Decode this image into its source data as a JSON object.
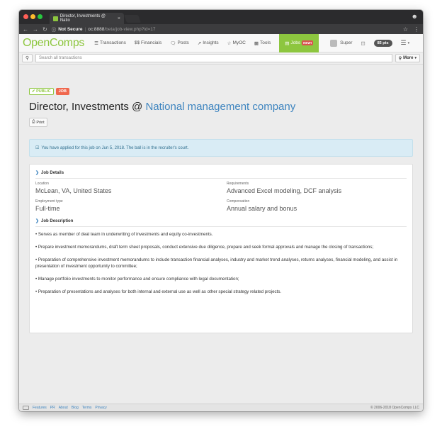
{
  "browser": {
    "tab_title": "Director, Investments @ Natio",
    "tab_close": "×",
    "security": "Not Secure",
    "url_host": "oc:8888",
    "url_path": "/beta/job-view.php?id=17"
  },
  "colors": {
    "brand": "#8dc63f",
    "link": "#3d84bf",
    "job_badge": "#f0684e",
    "alert_bg": "#d9ecf5"
  },
  "nav": {
    "logo": "OpenComps",
    "items": [
      {
        "label": "Transactions",
        "icon": "list-icon"
      },
      {
        "label": "$$ Financials",
        "icon": ""
      },
      {
        "label": "Posts",
        "icon": "chat-icon"
      },
      {
        "label": "Insights",
        "icon": "line-chart-icon"
      },
      {
        "label": "MyOC",
        "icon": "star-icon"
      },
      {
        "label": "Tools",
        "icon": "briefcase-icon"
      },
      {
        "label": "Jobs",
        "icon": "doc-icon",
        "badge": "NEW!"
      }
    ],
    "user": "Super",
    "points": "85 pts"
  },
  "search": {
    "placeholder": "Search all transactions",
    "more_label": "More"
  },
  "job": {
    "label_public": "PUBLIC",
    "label_job": "JOB",
    "title": "Director, Investments @ ",
    "company": "National management company",
    "print_label": "Print",
    "alert": "You have applied for this job on Jun 5, 2018. The ball is in the recruiter's court."
  },
  "details": {
    "heading": "Job Details",
    "location_label": "Location",
    "location": "McLean, VA, United States",
    "requirements_label": "Requirements",
    "requirements": "Advanced Excel modeling, DCF analysis",
    "employment_label": "Employment type",
    "employment": "Full-time",
    "compensation_label": "Compensation",
    "compensation": "Annual salary and bonus"
  },
  "description": {
    "heading": "Job Description",
    "bullets": [
      "• Serves as member of deal team in underwriting of investments and equity co-investments.",
      "• Prepare investment memorandums, draft term sheet proposals, conduct extensive due diligence, prepare and seek formal approvals and manage the closing of transactions;",
      "• Preparation of comprehensive investment memorandums to include transaction financial analyses, industry and market trend analyses, returns analyses, financial modeling, and assist in presentation of investment opportunity to committee;",
      "• Manage portfolio investments to monitor performance and ensure compliance with legal documentation;",
      "• Preparation of presentations and analyses for both internal and external use as well as other special strategy related projects."
    ]
  },
  "footer": {
    "links": [
      "Features",
      "PR",
      "About",
      "Blog",
      "Terms",
      "Privacy"
    ],
    "copyright": "© 2006-2018 OpenComps LLC"
  }
}
